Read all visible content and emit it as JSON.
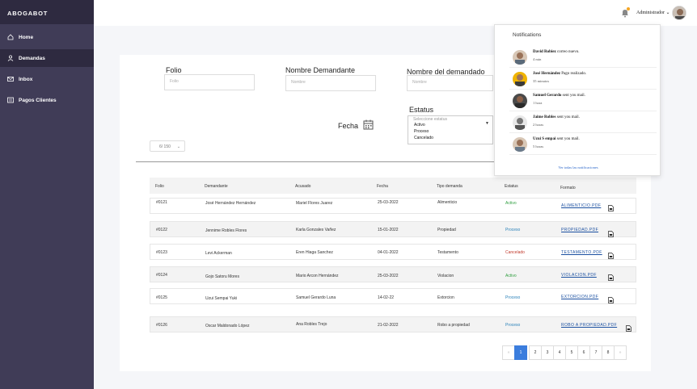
{
  "app": {
    "brand": "ABOGABOT"
  },
  "sidebar": {
    "items": [
      {
        "label": "Home",
        "icon": "home-icon"
      },
      {
        "label": "Demandas",
        "icon": "user-icon"
      },
      {
        "label": "Inbox",
        "icon": "mail-icon"
      },
      {
        "label": "Pagos Clientes",
        "icon": "receipt-icon"
      }
    ]
  },
  "header": {
    "admin_label": "Administrador"
  },
  "filters": {
    "folio": {
      "label": "Folio",
      "placeholder": "Folio"
    },
    "demandante": {
      "label": "Nombre Demandante",
      "placeholder": "Nombre"
    },
    "demandado": {
      "label": "Nombre del demandado",
      "placeholder": "Nombre"
    },
    "estatus": {
      "label": "Estatus",
      "placeholder": "Seleccione estatus",
      "options": [
        "Activo",
        "Proceso",
        "Cancelado"
      ]
    },
    "fecha": {
      "label": "Fecha"
    },
    "per_page": "6/ 150"
  },
  "table": {
    "headers": [
      "Folio",
      "Demandante",
      "Acusado",
      "Fecha",
      "Tipo demanda",
      "Estatus",
      "Formato"
    ],
    "rows": [
      {
        "folio": "#0121",
        "demandante": "José Hernández Hernández",
        "acusado": "Mariel Flores Juarez",
        "fecha": "25-03-2022",
        "tipo": "Alimenticio",
        "estatus": "Activo",
        "estatus_class": "activo",
        "formato": "ALIMENTICIO.PDF"
      },
      {
        "folio": "#0122",
        "demandante": "Jennime Robles Flores",
        "acusado": "Karla Gonzales Vañez",
        "fecha": "15-01-2022",
        "tipo": "Propiedad",
        "estatus": "Proceso",
        "estatus_class": "proceso",
        "formato": "PROPIEDAD.PDF"
      },
      {
        "folio": "#0123",
        "demandante": "Levi Ackerman",
        "acusado": "Eren Hiaga Sanchez",
        "fecha": "04-01-2022",
        "tipo": "Testamento",
        "estatus": "Cancelado",
        "estatus_class": "cancelado",
        "formato": "TESTAMENTO.PDF"
      },
      {
        "folio": "#0124",
        "demandante": "Gojo Satoru Mores",
        "acusado": "Mario Arcon Hernández",
        "fecha": "25-03-2022",
        "tipo": "Violacion",
        "estatus": "Activo",
        "estatus_class": "activo",
        "formato": "VIOLACION.PDF"
      },
      {
        "folio": "#0125",
        "demandante": "Uzui Sempai Yuki",
        "acusado": "Samuel Gerardo Luna",
        "fecha": "14-02-22",
        "tipo": "Extorcion",
        "estatus": "Proceso",
        "estatus_class": "proceso",
        "formato": "EXTORCION.PDF"
      },
      {
        "folio": "#0126",
        "demandante": "Oscar Maldonado López",
        "acusado": "Ana Robles Trejo",
        "fecha": "21-02-2022",
        "tipo": "Robo a propiedad",
        "estatus": "Proceso",
        "estatus_class": "proceso",
        "formato": "ROBO A PROPIEDAD.PDF"
      }
    ]
  },
  "pagination": {
    "prev": "«",
    "pages": [
      "1",
      "2",
      "3",
      "4",
      "5",
      "6",
      "7",
      "8"
    ],
    "next": "»",
    "current": "1"
  },
  "notifications": {
    "title": "Notifications",
    "items": [
      {
        "name": "David Robiez",
        "text": "correo nuevo.",
        "time": "4 min"
      },
      {
        "name": "José Hernández",
        "text": "Pago realizado.",
        "time": "35 minutos"
      },
      {
        "name": "Samuel Gerardo",
        "text": "sent you mail.",
        "time": "1 hora"
      },
      {
        "name": "Jaime Robles",
        "text": "sent you mail.",
        "time": "2 horas"
      },
      {
        "name": "Uzui S empai",
        "text": "sent you mail.",
        "time": "5 horas"
      }
    ],
    "view_all": "Ver todas las notificaciones"
  },
  "colors": {
    "sidebar": "#403c57",
    "sidebar_dark": "#2e2a40",
    "accent": "#3b7ddd",
    "activo": "#2e9e3e",
    "proceso": "#2980b9",
    "cancelado": "#c0392b"
  }
}
